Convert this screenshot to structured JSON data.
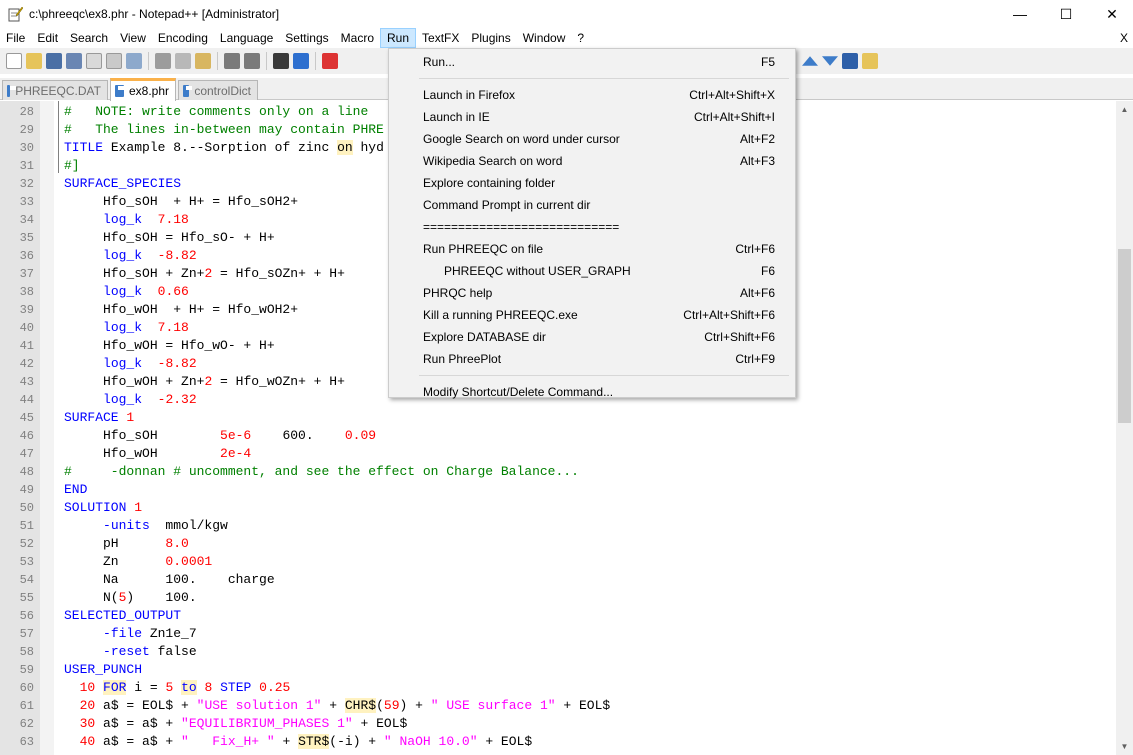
{
  "window": {
    "title": "c:\\phreeqc\\ex8.phr - Notepad++ [Administrator]",
    "minimize": "—",
    "maximize": "☐",
    "close": "✕"
  },
  "menubar": {
    "items": [
      "File",
      "Edit",
      "Search",
      "View",
      "Encoding",
      "Language",
      "Settings",
      "Macro",
      "Run",
      "TextFX",
      "Plugins",
      "Window",
      "?"
    ],
    "active": "Run",
    "close_doc": "X"
  },
  "tabs": [
    {
      "label": "PHREEQC.DAT",
      "active": false
    },
    {
      "label": "ex8.phr",
      "active": true
    },
    {
      "label": "controlDict",
      "active": false
    }
  ],
  "run_menu": [
    {
      "label": "Run...",
      "shortcut": "F5"
    },
    {
      "separator": true
    },
    {
      "label": "Launch in Firefox",
      "shortcut": "Ctrl+Alt+Shift+X"
    },
    {
      "label": "Launch in IE",
      "shortcut": "Ctrl+Alt+Shift+I"
    },
    {
      "label": "Google Search on word under cursor",
      "shortcut": "Alt+F2"
    },
    {
      "label": "Wikipedia Search on word",
      "shortcut": "Alt+F3"
    },
    {
      "label": "Explore containing folder",
      "shortcut": ""
    },
    {
      "label": "Command Prompt in current dir",
      "shortcut": ""
    },
    {
      "label": "============================",
      "shortcut": ""
    },
    {
      "label": "Run PHREEQC on file",
      "shortcut": "Ctrl+F6"
    },
    {
      "label": "PHREEQC without USER_GRAPH",
      "shortcut": "F6",
      "indent": true
    },
    {
      "label": "PHRQC help",
      "shortcut": "Alt+F6"
    },
    {
      "label": "Kill a running PHREEQC.exe",
      "shortcut": "Ctrl+Alt+Shift+F6"
    },
    {
      "label": "Explore DATABASE dir",
      "shortcut": "Ctrl+Shift+F6"
    },
    {
      "label": "Run PhreePlot",
      "shortcut": "Ctrl+F9"
    },
    {
      "separator": true
    },
    {
      "label": "Modify Shortcut/Delete Command...",
      "shortcut": ""
    }
  ],
  "editor": {
    "lines": [
      {
        "n": "28",
        "segs": [
          [
            "#   NOTE: write comments only on a line ",
            "cm"
          ]
        ]
      },
      {
        "n": "29",
        "segs": [
          [
            "#   The lines in-between may contain PHRE",
            "cm"
          ]
        ]
      },
      {
        "n": "30",
        "segs": [
          [
            "TITLE",
            "kw"
          ],
          [
            " Example 8.--Sorption of zinc ",
            "op"
          ],
          [
            "on",
            "hlop"
          ],
          [
            " hyd",
            "op"
          ]
        ]
      },
      {
        "n": "31",
        "segs": [
          [
            "#]",
            "cm"
          ]
        ]
      },
      {
        "n": "32",
        "segs": [
          [
            "SURFACE_SPECIES",
            "kw"
          ]
        ]
      },
      {
        "n": "33",
        "segs": [
          [
            "     Hfo_sOH  + H+ = Hfo_sOH2+",
            "op"
          ]
        ]
      },
      {
        "n": "34",
        "segs": [
          [
            "     ",
            "op"
          ],
          [
            "log_k",
            "id"
          ],
          [
            "  ",
            "op"
          ],
          [
            "7.18",
            "num"
          ]
        ]
      },
      {
        "n": "35",
        "segs": [
          [
            "     Hfo_sOH = Hfo_sO- + H+",
            "op"
          ]
        ]
      },
      {
        "n": "36",
        "segs": [
          [
            "     ",
            "op"
          ],
          [
            "log_k",
            "id"
          ],
          [
            "  ",
            "op"
          ],
          [
            "-8.82",
            "num"
          ]
        ]
      },
      {
        "n": "37",
        "segs": [
          [
            "     Hfo_sOH + Zn+",
            "op"
          ],
          [
            "2",
            "num"
          ],
          [
            " = Hfo_sOZn+ + H+",
            "op"
          ]
        ]
      },
      {
        "n": "38",
        "segs": [
          [
            "     ",
            "op"
          ],
          [
            "log_k",
            "id"
          ],
          [
            "  ",
            "op"
          ],
          [
            "0.66",
            "num"
          ]
        ]
      },
      {
        "n": "39",
        "segs": [
          [
            "     Hfo_wOH  + H+ = Hfo_wOH2+",
            "op"
          ]
        ]
      },
      {
        "n": "40",
        "segs": [
          [
            "     ",
            "op"
          ],
          [
            "log_k",
            "id"
          ],
          [
            "  ",
            "op"
          ],
          [
            "7.18",
            "num"
          ]
        ]
      },
      {
        "n": "41",
        "segs": [
          [
            "     Hfo_wOH = Hfo_wO- + H+",
            "op"
          ]
        ]
      },
      {
        "n": "42",
        "segs": [
          [
            "     ",
            "op"
          ],
          [
            "log_k",
            "id"
          ],
          [
            "  ",
            "op"
          ],
          [
            "-8.82",
            "num"
          ]
        ]
      },
      {
        "n": "43",
        "segs": [
          [
            "     Hfo_wOH + Zn+",
            "op"
          ],
          [
            "2",
            "num"
          ],
          [
            " = Hfo_wOZn+ + H+",
            "op"
          ]
        ]
      },
      {
        "n": "44",
        "segs": [
          [
            "     ",
            "op"
          ],
          [
            "log_k",
            "id"
          ],
          [
            "  ",
            "op"
          ],
          [
            "-2.32",
            "num"
          ]
        ]
      },
      {
        "n": "45",
        "segs": [
          [
            "SURFACE ",
            "kw"
          ],
          [
            "1",
            "num"
          ]
        ]
      },
      {
        "n": "46",
        "segs": [
          [
            "     Hfo_sOH        ",
            "op"
          ],
          [
            "5e-6",
            "num"
          ],
          [
            "    600.    ",
            "op"
          ],
          [
            "0.09",
            "num"
          ]
        ]
      },
      {
        "n": "47",
        "segs": [
          [
            "     Hfo_wOH        ",
            "op"
          ],
          [
            "2e-4",
            "num"
          ]
        ]
      },
      {
        "n": "48",
        "segs": [
          [
            "#     -donnan # uncomment, and see the effect on Charge Balance...",
            "cm"
          ]
        ]
      },
      {
        "n": "49",
        "segs": [
          [
            "END",
            "kw"
          ]
        ]
      },
      {
        "n": "50",
        "segs": [
          [
            "SOLUTION ",
            "kw"
          ],
          [
            "1",
            "num"
          ]
        ]
      },
      {
        "n": "51",
        "segs": [
          [
            "     ",
            "op"
          ],
          [
            "-units",
            "id"
          ],
          [
            "  mmol/kgw",
            "op"
          ]
        ]
      },
      {
        "n": "52",
        "segs": [
          [
            "     pH      ",
            "op"
          ],
          [
            "8.0",
            "num"
          ]
        ]
      },
      {
        "n": "53",
        "segs": [
          [
            "     Zn      ",
            "op"
          ],
          [
            "0.0001",
            "num"
          ]
        ]
      },
      {
        "n": "54",
        "segs": [
          [
            "     Na      100.    charge",
            "op"
          ]
        ]
      },
      {
        "n": "55",
        "segs": [
          [
            "     N(",
            "op"
          ],
          [
            "5",
            "num"
          ],
          [
            ")    100.",
            "op"
          ]
        ]
      },
      {
        "n": "56",
        "segs": [
          [
            "SELECTED_OUTPUT",
            "kw"
          ]
        ]
      },
      {
        "n": "57",
        "segs": [
          [
            "     ",
            "op"
          ],
          [
            "-file",
            "id"
          ],
          [
            " Zn1e_7",
            "op"
          ]
        ]
      },
      {
        "n": "58",
        "segs": [
          [
            "     ",
            "op"
          ],
          [
            "-reset",
            "id"
          ],
          [
            " false",
            "op"
          ]
        ]
      },
      {
        "n": "59",
        "segs": [
          [
            "USER_PUNCH",
            "kw"
          ]
        ]
      },
      {
        "n": "60",
        "segs": [
          [
            "  ",
            "op"
          ],
          [
            "10",
            "num"
          ],
          [
            " ",
            "op"
          ],
          [
            "FOR",
            "hlkw"
          ],
          [
            " i = ",
            "op"
          ],
          [
            "5",
            "num"
          ],
          [
            " ",
            "op"
          ],
          [
            "to",
            "hlkw"
          ],
          [
            " ",
            "op"
          ],
          [
            "8",
            "num"
          ],
          [
            " ",
            "op"
          ],
          [
            "STEP",
            "kw"
          ],
          [
            " ",
            "op"
          ],
          [
            "0.25",
            "num"
          ]
        ]
      },
      {
        "n": "61",
        "segs": [
          [
            "  ",
            "op"
          ],
          [
            "20",
            "num"
          ],
          [
            " a$ = EOL$ + ",
            "op"
          ],
          [
            "\"USE solution 1\"",
            "str2"
          ],
          [
            " + ",
            "op"
          ],
          [
            "CHR$",
            "hlop"
          ],
          [
            "(",
            "op"
          ],
          [
            "59",
            "num"
          ],
          [
            ") + ",
            "op"
          ],
          [
            "\" USE surface 1\"",
            "str2"
          ],
          [
            " + EOL$",
            "op"
          ]
        ]
      },
      {
        "n": "62",
        "segs": [
          [
            "  ",
            "op"
          ],
          [
            "30",
            "num"
          ],
          [
            " a$ = a$ + ",
            "op"
          ],
          [
            "\"EQUILIBRIUM_PHASES 1\"",
            "str2"
          ],
          [
            " + EOL$",
            "op"
          ]
        ]
      },
      {
        "n": "63",
        "segs": [
          [
            "  ",
            "op"
          ],
          [
            "40",
            "num"
          ],
          [
            " a$ = a$ + ",
            "op"
          ],
          [
            "\"   Fix_H+ \"",
            "str2"
          ],
          [
            " + ",
            "op"
          ],
          [
            "STR$",
            "hlop"
          ],
          [
            "(-i) + ",
            "op"
          ],
          [
            "\" NaOH 10.0\"",
            "str2"
          ],
          [
            " + EOL$",
            "op"
          ]
        ]
      }
    ]
  },
  "colors": {
    "accent_tab": "#fab14a",
    "menu_highlight": "#cce8ff",
    "keyword": "#0000ff",
    "comment": "#008000",
    "number": "#ff0000",
    "string": "#ff00ff"
  }
}
